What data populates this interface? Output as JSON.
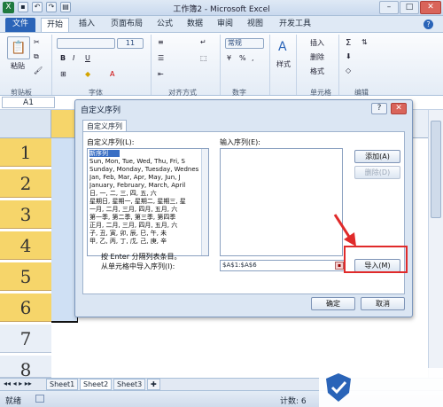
{
  "window": {
    "title": "工作簿2 - Microsoft Excel",
    "min": "–",
    "max": "□",
    "close": "✕"
  },
  "tabs": [
    "文件",
    "开始",
    "插入",
    "页面布局",
    "公式",
    "数据",
    "审阅",
    "视图",
    "开发工具"
  ],
  "ribbon": {
    "paste": "粘贴",
    "clipboard": "剪贴板",
    "font_group": "字体",
    "font_size": "11",
    "bold": "B",
    "italic": "I",
    "underline": "U",
    "align_group": "对齐方式",
    "number_format": "常规",
    "number_group": "数字",
    "style": "样式",
    "insert": "插入",
    "delete": "删除",
    "format": "格式",
    "cells_group": "单元格",
    "edit_group": "编辑",
    "sigma": "Σ"
  },
  "namebox": "A1",
  "rows": [
    "1",
    "2",
    "3",
    "4",
    "5",
    "6",
    "7",
    "8"
  ],
  "sheets": [
    "Sheet1",
    "Sheet2",
    "Sheet3"
  ],
  "status": {
    "ready": "就绪",
    "count": "计数: 6"
  },
  "dialog": {
    "title": "自定义序列",
    "help": "?",
    "close": "✕",
    "tab": "自定义序列",
    "list_label": "自定义序列(L):",
    "input_label": "输入序列(E):",
    "list_items": [
      "新序列",
      "Sun, Mon, Tue, Wed, Thu, Fri, S",
      "Sunday, Monday, Tuesday, Wednes",
      "Jan, Feb, Mar, Apr, May, Jun, J",
      "January, February, March, April",
      "日, 一, 二, 三, 四, 五, 六",
      "星期日, 星期一, 星期二, 星期三, 星",
      "一月, 二月, 三月, 四月, 五月, 六",
      "第一季, 第二季, 第三季, 第四季",
      "正月, 二月, 三月, 四月, 五月, 六",
      "子, 丑, 寅, 卯, 辰, 巳, 午, 未",
      "甲, 乙, 丙, 丁, 戊, 己, 庚, 辛"
    ],
    "add": "添加(A)",
    "delete": "删除(D)",
    "hint": "按 Enter 分隔列表条目。",
    "import_label": "从单元格中导入序列(I):",
    "import_range": "$A$1:$A$6",
    "import_btn": "导入(M)",
    "ok": "确定",
    "cancel": "取消"
  },
  "colors": {
    "accent": "#2a64b8",
    "highlight": "#e02a2a",
    "row_selected": "#f6d56a"
  }
}
